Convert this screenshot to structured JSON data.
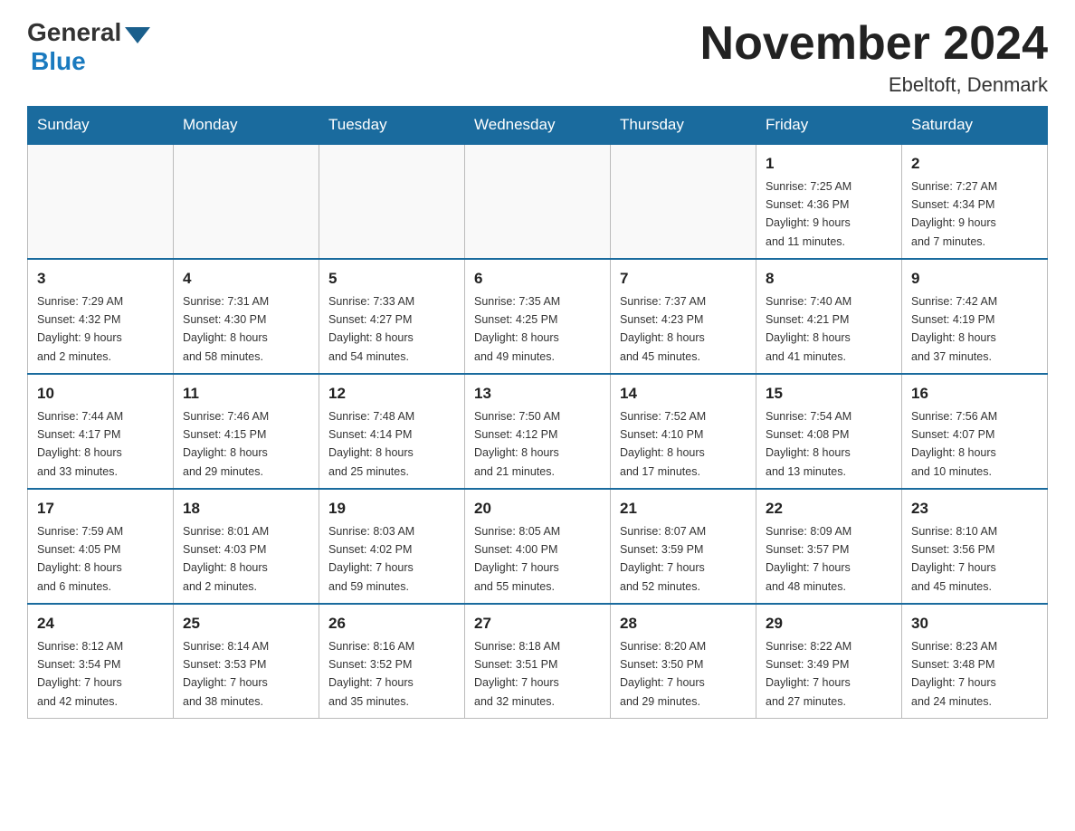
{
  "header": {
    "logo_general": "General",
    "logo_blue": "Blue",
    "month_title": "November 2024",
    "location": "Ebeltoft, Denmark"
  },
  "weekdays": [
    "Sunday",
    "Monday",
    "Tuesday",
    "Wednesday",
    "Thursday",
    "Friday",
    "Saturday"
  ],
  "weeks": [
    [
      {
        "day": "",
        "info": ""
      },
      {
        "day": "",
        "info": ""
      },
      {
        "day": "",
        "info": ""
      },
      {
        "day": "",
        "info": ""
      },
      {
        "day": "",
        "info": ""
      },
      {
        "day": "1",
        "info": "Sunrise: 7:25 AM\nSunset: 4:36 PM\nDaylight: 9 hours\nand 11 minutes."
      },
      {
        "day": "2",
        "info": "Sunrise: 7:27 AM\nSunset: 4:34 PM\nDaylight: 9 hours\nand 7 minutes."
      }
    ],
    [
      {
        "day": "3",
        "info": "Sunrise: 7:29 AM\nSunset: 4:32 PM\nDaylight: 9 hours\nand 2 minutes."
      },
      {
        "day": "4",
        "info": "Sunrise: 7:31 AM\nSunset: 4:30 PM\nDaylight: 8 hours\nand 58 minutes."
      },
      {
        "day": "5",
        "info": "Sunrise: 7:33 AM\nSunset: 4:27 PM\nDaylight: 8 hours\nand 54 minutes."
      },
      {
        "day": "6",
        "info": "Sunrise: 7:35 AM\nSunset: 4:25 PM\nDaylight: 8 hours\nand 49 minutes."
      },
      {
        "day": "7",
        "info": "Sunrise: 7:37 AM\nSunset: 4:23 PM\nDaylight: 8 hours\nand 45 minutes."
      },
      {
        "day": "8",
        "info": "Sunrise: 7:40 AM\nSunset: 4:21 PM\nDaylight: 8 hours\nand 41 minutes."
      },
      {
        "day": "9",
        "info": "Sunrise: 7:42 AM\nSunset: 4:19 PM\nDaylight: 8 hours\nand 37 minutes."
      }
    ],
    [
      {
        "day": "10",
        "info": "Sunrise: 7:44 AM\nSunset: 4:17 PM\nDaylight: 8 hours\nand 33 minutes."
      },
      {
        "day": "11",
        "info": "Sunrise: 7:46 AM\nSunset: 4:15 PM\nDaylight: 8 hours\nand 29 minutes."
      },
      {
        "day": "12",
        "info": "Sunrise: 7:48 AM\nSunset: 4:14 PM\nDaylight: 8 hours\nand 25 minutes."
      },
      {
        "day": "13",
        "info": "Sunrise: 7:50 AM\nSunset: 4:12 PM\nDaylight: 8 hours\nand 21 minutes."
      },
      {
        "day": "14",
        "info": "Sunrise: 7:52 AM\nSunset: 4:10 PM\nDaylight: 8 hours\nand 17 minutes."
      },
      {
        "day": "15",
        "info": "Sunrise: 7:54 AM\nSunset: 4:08 PM\nDaylight: 8 hours\nand 13 minutes."
      },
      {
        "day": "16",
        "info": "Sunrise: 7:56 AM\nSunset: 4:07 PM\nDaylight: 8 hours\nand 10 minutes."
      }
    ],
    [
      {
        "day": "17",
        "info": "Sunrise: 7:59 AM\nSunset: 4:05 PM\nDaylight: 8 hours\nand 6 minutes."
      },
      {
        "day": "18",
        "info": "Sunrise: 8:01 AM\nSunset: 4:03 PM\nDaylight: 8 hours\nand 2 minutes."
      },
      {
        "day": "19",
        "info": "Sunrise: 8:03 AM\nSunset: 4:02 PM\nDaylight: 7 hours\nand 59 minutes."
      },
      {
        "day": "20",
        "info": "Sunrise: 8:05 AM\nSunset: 4:00 PM\nDaylight: 7 hours\nand 55 minutes."
      },
      {
        "day": "21",
        "info": "Sunrise: 8:07 AM\nSunset: 3:59 PM\nDaylight: 7 hours\nand 52 minutes."
      },
      {
        "day": "22",
        "info": "Sunrise: 8:09 AM\nSunset: 3:57 PM\nDaylight: 7 hours\nand 48 minutes."
      },
      {
        "day": "23",
        "info": "Sunrise: 8:10 AM\nSunset: 3:56 PM\nDaylight: 7 hours\nand 45 minutes."
      }
    ],
    [
      {
        "day": "24",
        "info": "Sunrise: 8:12 AM\nSunset: 3:54 PM\nDaylight: 7 hours\nand 42 minutes."
      },
      {
        "day": "25",
        "info": "Sunrise: 8:14 AM\nSunset: 3:53 PM\nDaylight: 7 hours\nand 38 minutes."
      },
      {
        "day": "26",
        "info": "Sunrise: 8:16 AM\nSunset: 3:52 PM\nDaylight: 7 hours\nand 35 minutes."
      },
      {
        "day": "27",
        "info": "Sunrise: 8:18 AM\nSunset: 3:51 PM\nDaylight: 7 hours\nand 32 minutes."
      },
      {
        "day": "28",
        "info": "Sunrise: 8:20 AM\nSunset: 3:50 PM\nDaylight: 7 hours\nand 29 minutes."
      },
      {
        "day": "29",
        "info": "Sunrise: 8:22 AM\nSunset: 3:49 PM\nDaylight: 7 hours\nand 27 minutes."
      },
      {
        "day": "30",
        "info": "Sunrise: 8:23 AM\nSunset: 3:48 PM\nDaylight: 7 hours\nand 24 minutes."
      }
    ]
  ]
}
